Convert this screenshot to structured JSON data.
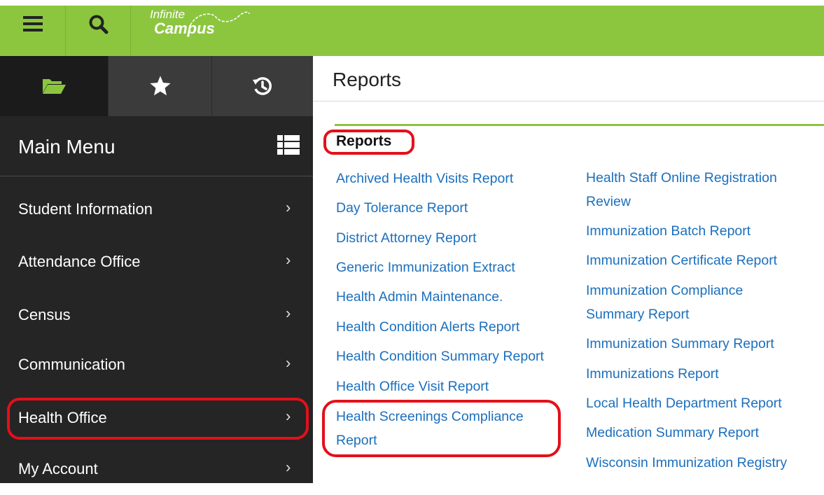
{
  "header": {
    "logo_line1": "Infinite",
    "logo_line2": "Campus",
    "menu_icon": "hamburger-menu-icon",
    "search_icon": "search-icon",
    "accent_color": "#8cc63f"
  },
  "sidebar": {
    "tabs": [
      {
        "icon": "folder-open-icon",
        "active": true
      },
      {
        "icon": "star-icon",
        "active": false
      },
      {
        "icon": "history-icon",
        "active": false
      }
    ],
    "title": "Main Menu",
    "items": [
      {
        "label": "Student Information"
      },
      {
        "label": "Attendance Office"
      },
      {
        "label": "Census"
      },
      {
        "label": "Communication"
      },
      {
        "label": "Health Office"
      },
      {
        "label": "My Account"
      }
    ],
    "chevron": "›"
  },
  "main": {
    "title": "Reports",
    "section_heading": "Reports",
    "column1": [
      "Archived Health Visits Report",
      "Day Tolerance Report",
      "District Attorney Report",
      "Generic Immunization Extract",
      "Health Admin Maintenance.",
      "Health Condition Alerts Report",
      "Health Condition Summary Report",
      "Health Office Visit Report",
      "Health Screenings Compliance Report"
    ],
    "column2": [
      "Health Staff Online Registration Review",
      "Immunization Batch Report",
      "Immunization Certificate Report",
      "Immunization Compliance Summary Report",
      "Immunization Summary Report",
      "Immunizations Report",
      "Local Health Department Report",
      "Medication Summary Report",
      "Wisconsin Immunization Registry"
    ]
  },
  "highlight_color": "#e3101a",
  "link_color": "#1b6fbd"
}
